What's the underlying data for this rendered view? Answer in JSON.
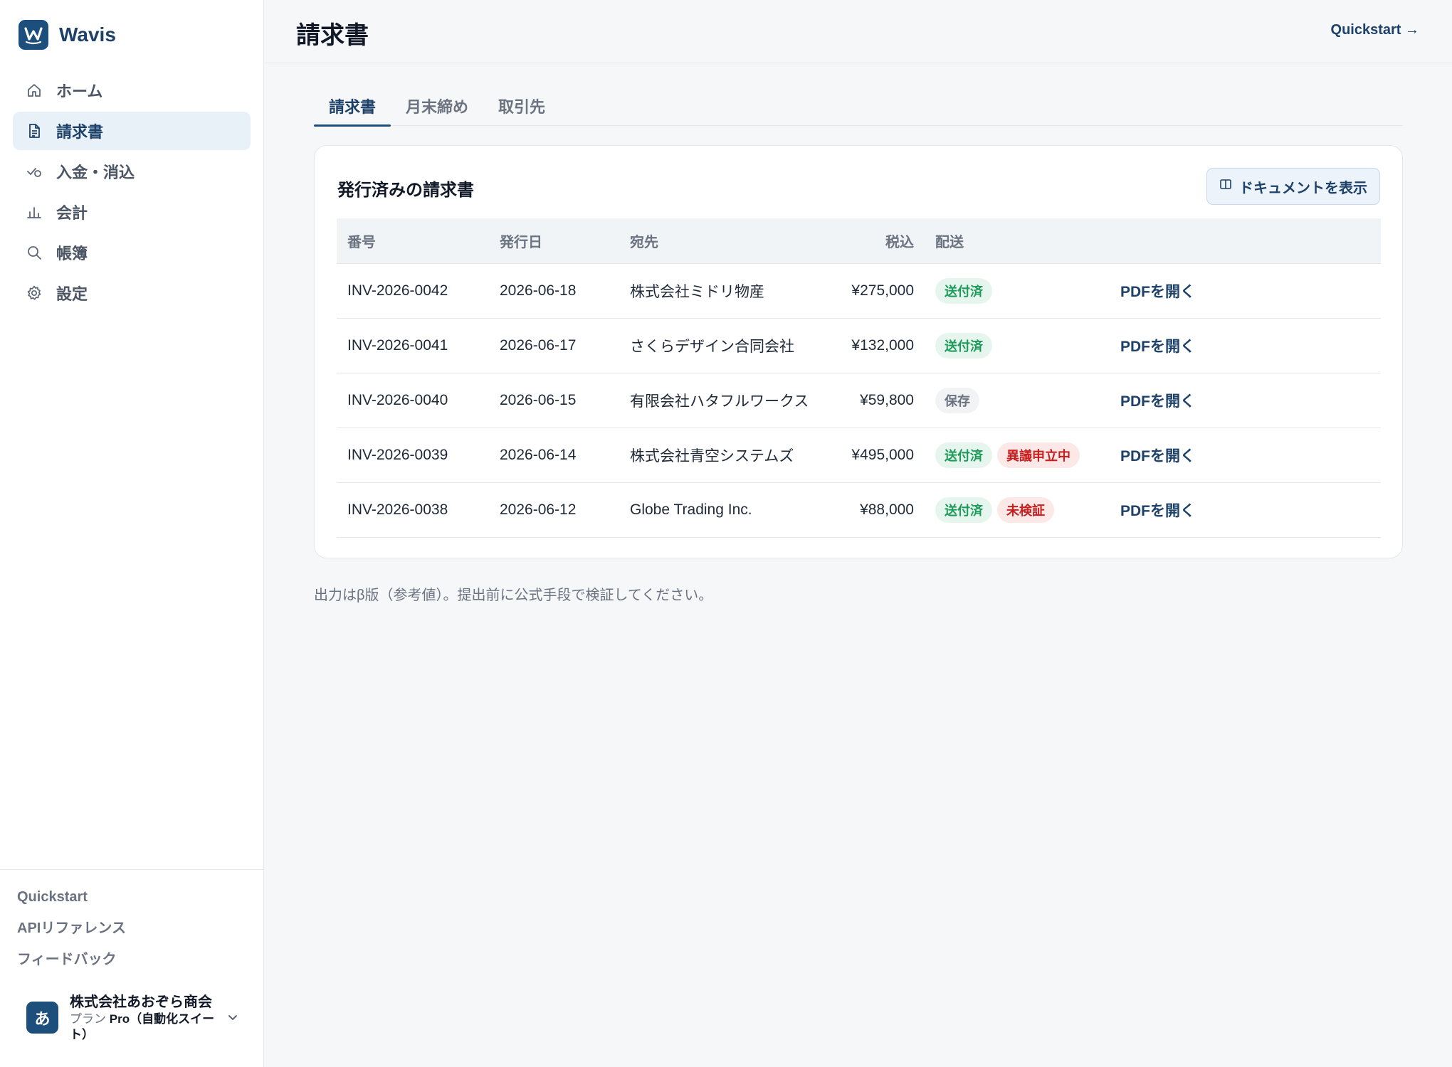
{
  "app": {
    "name": "Wavis",
    "logo_letter": "W"
  },
  "sidebar": {
    "items": [
      {
        "label": "ホーム",
        "icon": "home-icon",
        "active": false
      },
      {
        "label": "請求書",
        "icon": "document-icon",
        "active": true
      },
      {
        "label": "入金・消込",
        "icon": "check-coin-icon",
        "active": false
      },
      {
        "label": "会計",
        "icon": "bar-chart-icon",
        "active": false
      },
      {
        "label": "帳簿",
        "icon": "search-icon",
        "active": false
      },
      {
        "label": "設定",
        "icon": "gear-icon",
        "active": false
      }
    ],
    "links": [
      "Quickstart",
      "APIリファレンス",
      "フィードバック"
    ],
    "account": {
      "avatar": "あ",
      "name": "株式会社あおぞら商会",
      "plan_label": "プラン",
      "plan_value": "Pro（自動化スイート）"
    }
  },
  "header": {
    "title": "請求書",
    "quickstart": "Quickstart →"
  },
  "tabs": [
    "請求書",
    "月末締め",
    "取引先"
  ],
  "card": {
    "title": "発行済みの請求書",
    "doc_button": "ドキュメントを表示",
    "columns": [
      "番号",
      "発行日",
      "宛先",
      "税込",
      "配送"
    ],
    "rows": [
      {
        "number": "INV-2026-0042",
        "date": "2026-06-18",
        "to": "株式会社ミドリ物産",
        "amount": "¥275,000",
        "badges": [
          {
            "text": "送付済",
            "tone": "green"
          }
        ],
        "action": "PDFを開く"
      },
      {
        "number": "INV-2026-0041",
        "date": "2026-06-17",
        "to": "さくらデザイン合同会社",
        "amount": "¥132,000",
        "badges": [
          {
            "text": "送付済",
            "tone": "green"
          }
        ],
        "action": "PDFを開く"
      },
      {
        "number": "INV-2026-0040",
        "date": "2026-06-15",
        "to": "有限会社ハタフルワークス",
        "amount": "¥59,800",
        "badges": [
          {
            "text": "保存",
            "tone": "gray"
          }
        ],
        "action": "PDFを開く"
      },
      {
        "number": "INV-2026-0039",
        "date": "2026-06-14",
        "to": "株式会社青空システムズ",
        "amount": "¥495,000",
        "badges": [
          {
            "text": "送付済",
            "tone": "green"
          },
          {
            "text": "異議申立中",
            "tone": "red"
          }
        ],
        "action": "PDFを開く"
      },
      {
        "number": "INV-2026-0038",
        "date": "2026-06-12",
        "to": "Globe Trading Inc.",
        "amount": "¥88,000",
        "badges": [
          {
            "text": "送付済",
            "tone": "green"
          },
          {
            "text": "未検証",
            "tone": "red"
          }
        ],
        "action": "PDFを開く"
      }
    ]
  },
  "footnote": "出力はβ版（参考値）。提出前に公式手段で検証してください。",
  "colors": {
    "brand": "#1d4f7c",
    "active_bg": "#e8f0f8",
    "badge_green": "#1e9a5b",
    "badge_red": "#c81e1e"
  }
}
